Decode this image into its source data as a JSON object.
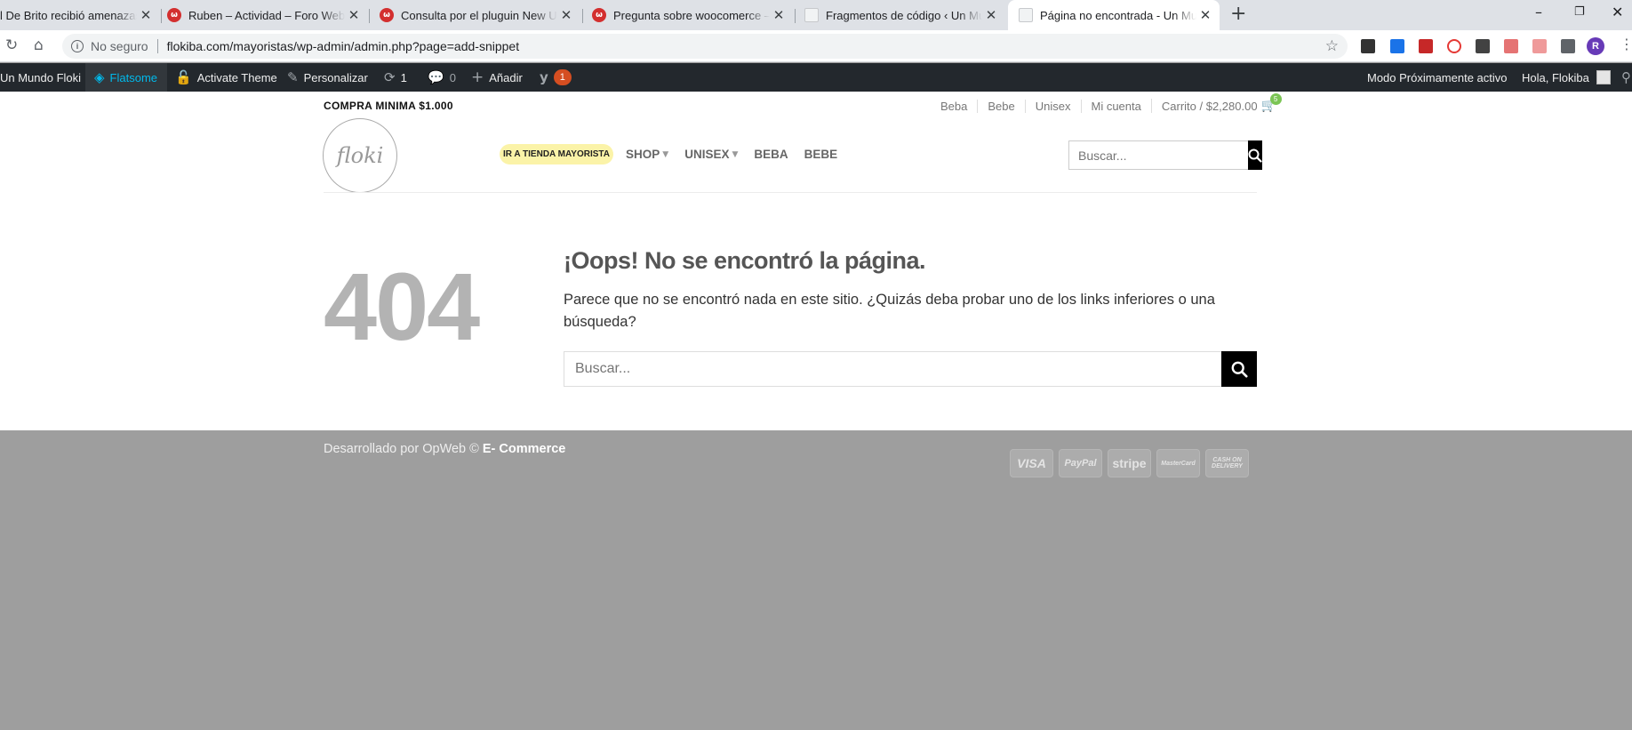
{
  "browser": {
    "tabs": [
      {
        "title": "l De Brito recibió amenazas",
        "favicon": "page-icon"
      },
      {
        "title": "Ruben – Actividad – Foro Webempresa",
        "favicon": "webempresa-icon"
      },
      {
        "title": "Consulta por el pluguin New User",
        "favicon": "webempresa-icon"
      },
      {
        "title": "Pregunta sobre woocomerce – Foro",
        "favicon": "webempresa-icon"
      },
      {
        "title": "Fragmentos de código ‹ Un Mundo",
        "favicon": "page-icon"
      },
      {
        "title": "Página no encontrada - Un Mundo Floki",
        "favicon": "page-icon"
      }
    ],
    "insecure_label": "No seguro",
    "url": "flokiba.com/mayoristas/wp-admin/admin.php?page=add-snippet",
    "profile_initial": "R"
  },
  "adminbar": {
    "site_name": "Un Mundo Floki",
    "theme": "Flatsome",
    "activate": "Activate Theme",
    "customize": "Personalizar",
    "updates_count": "1",
    "comments_count": "0",
    "add_new": "Añadir",
    "yoast_badge": "1",
    "coming_soon": "Modo Próximamente activo",
    "greeting": "Hola, Flokiba"
  },
  "header": {
    "topbar_text": "COMPRA MINIMA $1.000",
    "top_links": [
      "Beba",
      "Bebe",
      "Unisex",
      "Mi cuenta"
    ],
    "cart_label": "Carrito / $2,280.00",
    "cart_count": "5",
    "logo_text": "floki",
    "nav_pill": "IR A TIENDA MAYORISTA",
    "nav": [
      "SHOP",
      "UNISEX",
      "BEBA",
      "BEBE"
    ],
    "search_placeholder": "Buscar..."
  },
  "content": {
    "code": "404",
    "title": "¡Oops! No se encontró la página.",
    "description": "Parece que no se encontró nada en este sitio. ¿Quizás deba probar uno de los links inferiores o una búsqueda?",
    "search_placeholder": "Buscar..."
  },
  "footer": {
    "credit_prefix": "Desarrollado por OpWeb ©",
    "credit_bold": "E- Commerce",
    "payments": [
      "VISA",
      "PayPal",
      "stripe",
      "MasterCard",
      "CASH ON DELIVERY"
    ]
  },
  "colors": {
    "adminbar_bg": "#23282d",
    "accent_blue": "#00b9eb",
    "pill_bg": "#fbf3a8",
    "footer_bg": "#9e9e9e",
    "cart_badge": "#7bc555"
  }
}
